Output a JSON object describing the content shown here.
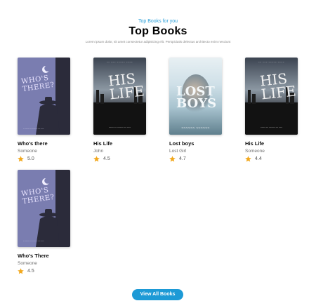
{
  "header": {
    "eyebrow": "Top Books for you",
    "title": "Top Books",
    "subtitle": "Lorem ipsum dolor, sit amet consectetur adipisicing elit. Perspiciatis delectus architecto enim nesciunt"
  },
  "books": [
    {
      "title": "Who's there",
      "author": "Someone",
      "rating": "5.0",
      "cover": {
        "style": "purple",
        "title_line1": "WHO'S",
        "title_line2": "THERE?"
      }
    },
    {
      "title": "His Life",
      "author": "John",
      "rating": "4.5",
      "cover": {
        "style": "dark",
        "title_line1": "HIS",
        "title_line2": "LIFE"
      }
    },
    {
      "title": "Lost boys",
      "author": "Lost Girl",
      "rating": "4.7",
      "cover": {
        "style": "lost",
        "title_line1": "LOST",
        "title_line2": "BOYS"
      }
    },
    {
      "title": "His Life",
      "author": "Someone",
      "rating": "4.4",
      "cover": {
        "style": "dark",
        "title_line1": "HIS",
        "title_line2": "LIFE"
      }
    },
    {
      "title": "Who's There",
      "author": "Someone",
      "rating": "4.5",
      "cover": {
        "style": "purple",
        "title_line1": "WHO'S",
        "title_line2": "THERE?"
      }
    }
  ],
  "cta": {
    "label": "View All Books"
  },
  "colors": {
    "accent": "#1d9ad6",
    "star": "#f2a81d",
    "eyebrow": "#2a9fd8"
  }
}
